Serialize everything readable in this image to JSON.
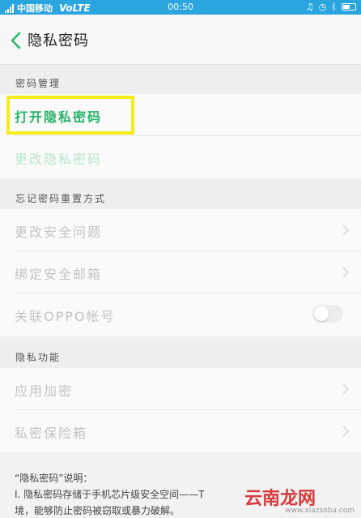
{
  "status_bar": {
    "carrier": "中国移动",
    "network": "VoLTE",
    "time": "00:50"
  },
  "header": {
    "title": "隐私密码"
  },
  "sections": {
    "password_mgmt": {
      "title": "密码管理",
      "open_label": "打开隐私密码",
      "change_label": "更改隐私密码"
    },
    "reset": {
      "title": "忘记密码重置方式",
      "security_question": "更改安全问题",
      "bind_email": "绑定安全邮箱",
      "link_account": "关联OPPO帐号"
    },
    "privacy": {
      "title": "隐私功能",
      "app_lock": "应用加密",
      "safe_box": "私密保险箱"
    }
  },
  "footer": {
    "heading": "“隐私密码”说明：",
    "line1": "I. 隐私密码存储于手机芯片级安全空间——T",
    "line2": "境，能够防止密码被窃取或暴力破解。"
  },
  "watermark": {
    "text": "云南龙网",
    "url": "www.xlazsoba.com"
  },
  "colors": {
    "accent": "#26b46a",
    "status_bar": "#2ba5e0",
    "highlight": "#f5ec1a"
  }
}
